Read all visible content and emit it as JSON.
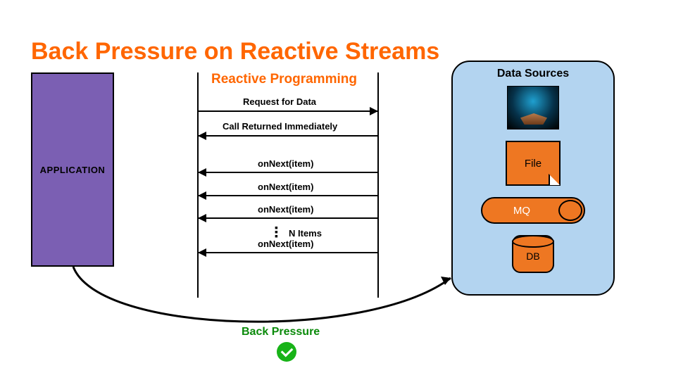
{
  "title": "Back Pressure on Reactive Streams",
  "subtitle": "Reactive Programming",
  "application_label": "APPLICATION",
  "messages": {
    "request": "Request for Data",
    "call_returned": "Call Returned Immediately",
    "on_next_1": "onNext(item)",
    "on_next_2": "onNext(item)",
    "on_next_3": "onNext(item)",
    "n_items": "N Items",
    "on_next_last": "onNext(item)"
  },
  "data_sources": {
    "title": "Data Sources",
    "file_label": "File",
    "mq_label": "MQ",
    "db_label": "DB"
  },
  "back_pressure_label": "Back Pressure",
  "colors": {
    "accent_orange": "#ff6600",
    "fill_orange": "#ee7722",
    "purple": "#7b5fb3",
    "panel_blue": "#b3d4f0",
    "green": "#18b318"
  }
}
